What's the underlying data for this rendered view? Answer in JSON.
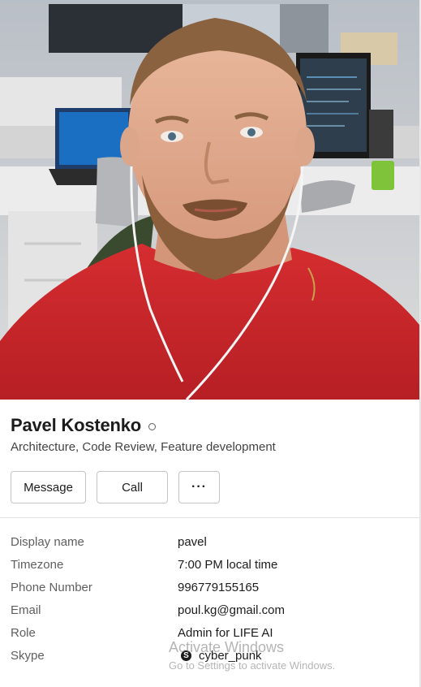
{
  "profile": {
    "name": "Pavel Kostenko",
    "title": "Architecture, Code Review, Feature development",
    "presence_icon": "presence-away-ring"
  },
  "actions": {
    "message_label": "Message",
    "call_label": "Call",
    "more_label": "···"
  },
  "fields": {
    "display_name": {
      "label": "Display name",
      "value": "pavel"
    },
    "timezone": {
      "label": "Timezone",
      "value": "7:00 PM local time"
    },
    "phone": {
      "label": "Phone Number",
      "value": "996779155165"
    },
    "email": {
      "label": "Email",
      "value": "poul.kg@gmail.com"
    },
    "role": {
      "label": "Role",
      "value": "Admin for LIFE AI"
    },
    "skype": {
      "label": "Skype",
      "value": "cyber_punk",
      "icon": "skype-icon",
      "icon_glyph": "S"
    }
  },
  "watermark": {
    "title": "Activate Windows",
    "subtitle": "Go to Settings to activate Windows."
  },
  "colors": {
    "shirt": "#c9262b",
    "label_text": "#616061",
    "primary_text": "#1d1c1d",
    "button_border": "#c5c4c5"
  }
}
